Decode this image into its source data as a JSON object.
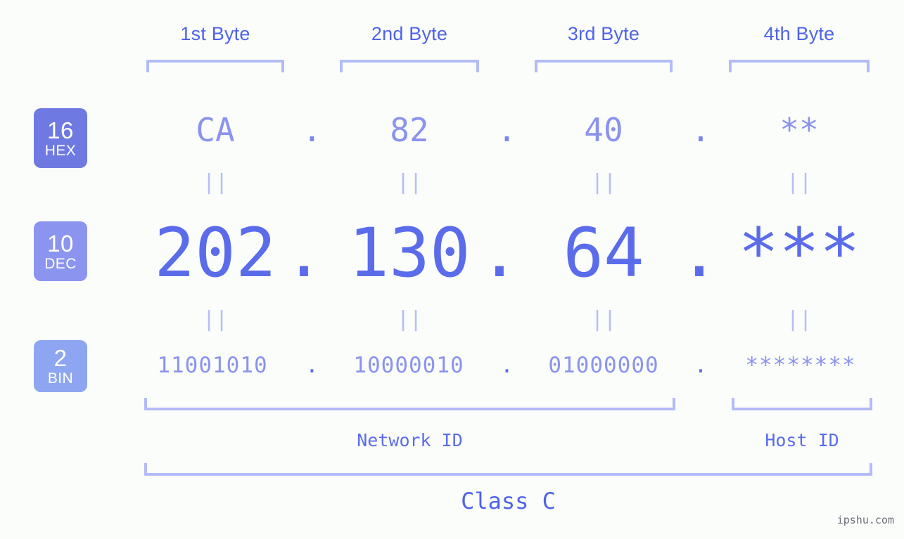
{
  "watermark": "ipshu.com",
  "byte_headers": [
    {
      "label": "1st Byte"
    },
    {
      "label": "2nd Byte"
    },
    {
      "label": "3rd Byte"
    },
    {
      "label": "4th Byte"
    }
  ],
  "radix_badges": [
    {
      "radix": "16",
      "name": "HEX",
      "color": "#6f79e2"
    },
    {
      "radix": "10",
      "name": "DEC",
      "color": "#8b95ef"
    },
    {
      "radix": "2",
      "name": "BIN",
      "color": "#8ea6f2"
    }
  ],
  "separator": ".",
  "equals_marker": "||",
  "rows": {
    "hex": {
      "octets": [
        "CA",
        "82",
        "40",
        "**"
      ]
    },
    "dec": {
      "octets": [
        "202",
        "130",
        "64",
        "***"
      ]
    },
    "bin": {
      "octets": [
        "11001010",
        "10000010",
        "01000000",
        "********"
      ]
    }
  },
  "segments": {
    "network_id": "Network ID",
    "host_id": "Host ID",
    "class": "Class C"
  },
  "colors": {
    "background": "#fbfdfa",
    "bracket": "#b3bcf7",
    "header_text": "#4f63ea",
    "hex_text": "#8b93ee",
    "dec_text": "#5b6ceb",
    "bin_text": "#8b93ee",
    "equals": "#b6bef8"
  }
}
